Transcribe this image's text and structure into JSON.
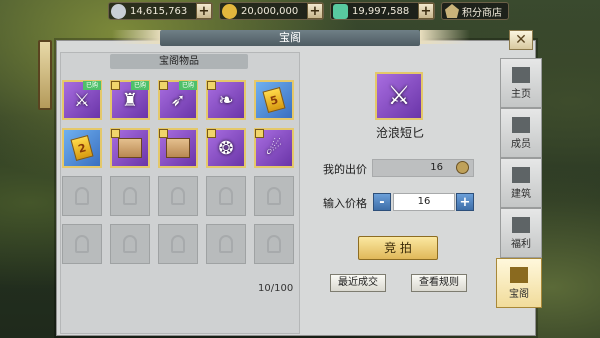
{
  "currency": [
    {
      "name": "silver",
      "amount": "14,615,763",
      "color": "#c9cfd6"
    },
    {
      "name": "gold",
      "amount": "20,000,000",
      "color": "#e3b73d"
    },
    {
      "name": "jade",
      "amount": "19,997,588",
      "color": "#58c9a0"
    }
  ],
  "top_plus": "+",
  "shop_label": "积分商店",
  "window_title": "宝阁",
  "close_label": "✕",
  "inventory": {
    "title": "宝阁物品",
    "count": "10/100",
    "items": [
      {
        "kind": "dagger",
        "glyph": "⚔",
        "badge": "已购",
        "tag": false,
        "rarity": "purple"
      },
      {
        "kind": "armor",
        "glyph": "♜",
        "badge": "已购",
        "tag": true,
        "rarity": "purple"
      },
      {
        "kind": "spear",
        "glyph": "➶",
        "badge": "已购",
        "tag": true,
        "rarity": "purple"
      },
      {
        "kind": "bracer",
        "glyph": "❧",
        "badge": "",
        "tag": true,
        "rarity": "purple"
      },
      {
        "kind": "coin",
        "glyph": "5",
        "badge": "",
        "tag": false,
        "rarity": "blue"
      },
      {
        "kind": "coin",
        "glyph": "2",
        "badge": "",
        "tag": false,
        "rarity": "blue"
      },
      {
        "kind": "scroll",
        "glyph": "",
        "badge": "",
        "tag": true,
        "rarity": "purple"
      },
      {
        "kind": "scroll",
        "glyph": "",
        "badge": "",
        "tag": true,
        "rarity": "purple"
      },
      {
        "kind": "pouch",
        "glyph": "❂",
        "badge": "",
        "tag": true,
        "rarity": "purple"
      },
      {
        "kind": "amulet",
        "glyph": "☄",
        "badge": "",
        "tag": true,
        "rarity": "purple"
      }
    ]
  },
  "detail": {
    "item_name": "沧浪短匕",
    "my_bid_label": "我的出价",
    "my_bid_value": "16",
    "input_label": "输入价格",
    "input_value": "16",
    "minus": "-",
    "plus": "+",
    "auction_button": "竞 拍",
    "recent_button": "最近成交",
    "rules_button": "查看规则"
  },
  "tabs": [
    {
      "label": "主页",
      "icon": "home-icon",
      "active": false
    },
    {
      "label": "成员",
      "icon": "members-icon",
      "active": false
    },
    {
      "label": "建筑",
      "icon": "building-icon",
      "active": false
    },
    {
      "label": "福利",
      "icon": "welfare-icon",
      "active": false
    },
    {
      "label": "宝阁",
      "icon": "treasure-icon",
      "active": true
    }
  ]
}
